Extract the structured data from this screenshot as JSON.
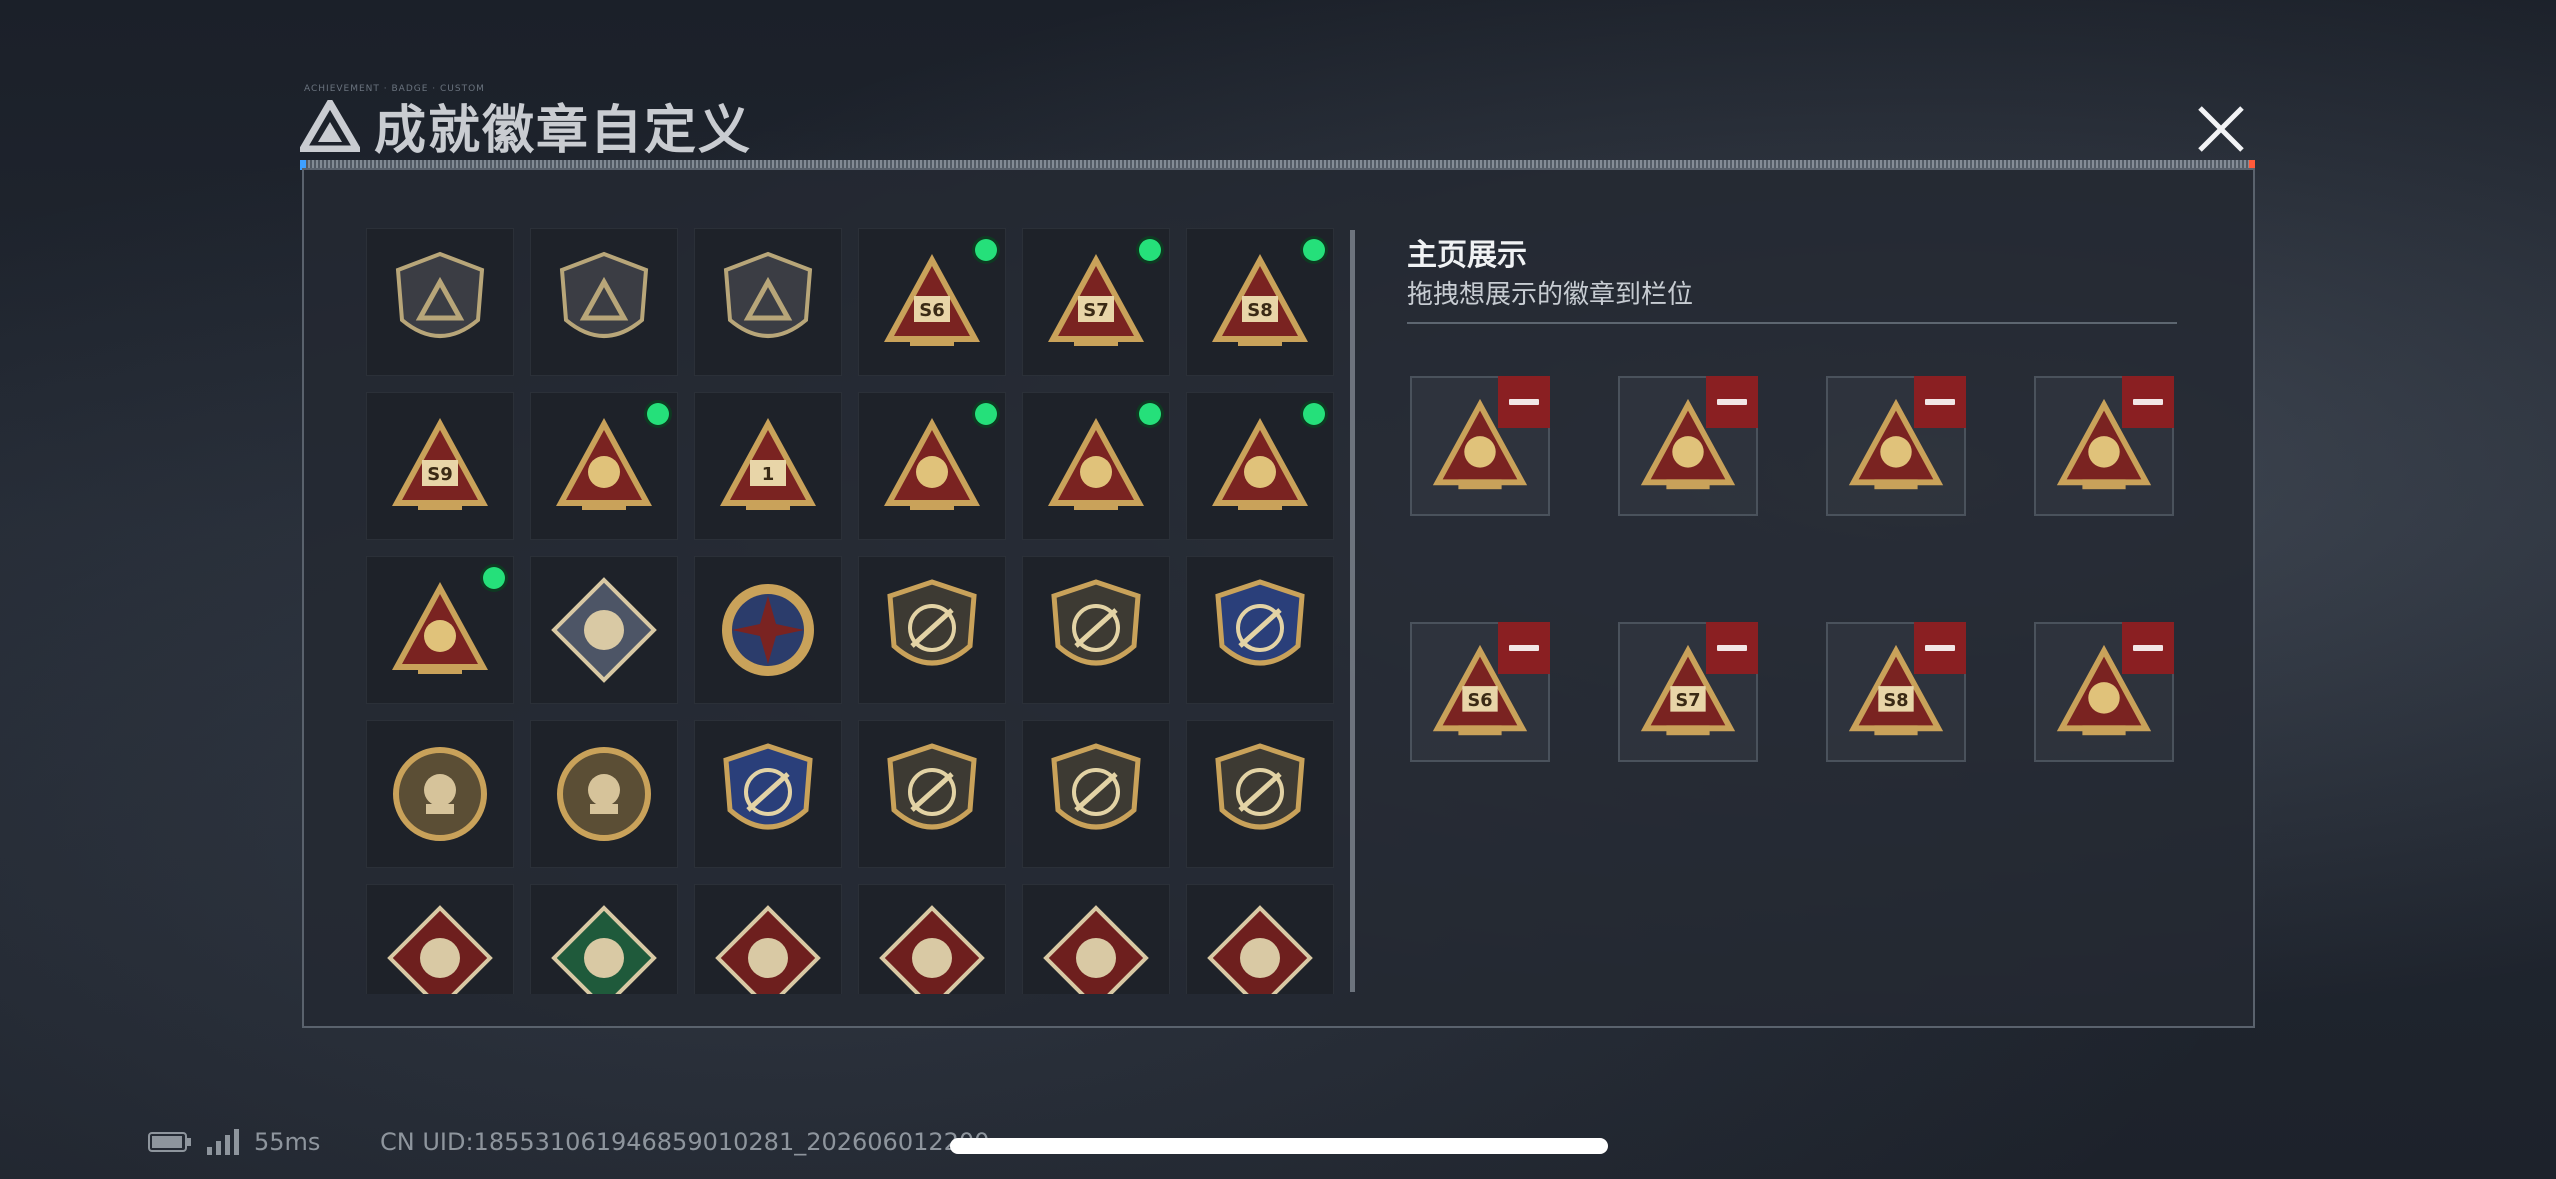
{
  "header": {
    "title": "成就徽章自定义",
    "tiny_text": "ACHIEVEMENT · BADGE · CUSTOM"
  },
  "badge_grid": {
    "rows": [
      [
        {
          "icon": "gray-triangle-shield-icon",
          "new": false
        },
        {
          "icon": "helicopter-shield-icon",
          "new": false
        },
        {
          "icon": "dagger-shield-icon",
          "new": false
        },
        {
          "icon": "s6-triangle-badge-icon",
          "label": "S6",
          "new": true
        },
        {
          "icon": "s7-triangle-badge-icon",
          "label": "S7",
          "new": true
        },
        {
          "icon": "s8-triangle-badge-icon",
          "label": "S8",
          "new": true
        }
      ],
      [
        {
          "icon": "s9-plane-triangle-badge-icon",
          "label": "S9",
          "new": false
        },
        {
          "icon": "boat-triangle-badge-icon",
          "new": true
        },
        {
          "icon": "number-one-triangle-badge-icon",
          "label": "1",
          "new": false
        },
        {
          "icon": "usb-triangle-badge-icon",
          "new": true
        },
        {
          "icon": "dice-triangle-badge-icon",
          "new": true
        },
        {
          "icon": "soldiers-triangle-badge-icon",
          "new": true
        }
      ],
      [
        {
          "icon": "rocket-triangle-badge-icon",
          "new": true
        },
        {
          "icon": "rose-diamond-badge-icon",
          "new": false
        },
        {
          "icon": "star-compass-badge-icon",
          "new": false
        },
        {
          "icon": "wing-shield-badge-icon",
          "new": false
        },
        {
          "icon": "laurel-shield-badge-icon",
          "new": false
        },
        {
          "icon": "blue-gem-shield-badge-icon",
          "new": false
        }
      ],
      [
        {
          "icon": "skull-round-badge-icon",
          "new": false
        },
        {
          "icon": "crosshair-skull-round-badge-icon",
          "new": false
        },
        {
          "icon": "blue-sniper-shield-badge-icon",
          "new": false
        },
        {
          "icon": "rifle-shield-badge-icon",
          "new": false
        },
        {
          "icon": "rifle-round-shield-badge-icon",
          "new": false
        },
        {
          "icon": "gold-rifle-shield-badge-icon",
          "new": false
        }
      ],
      [
        {
          "icon": "wolf-diamond-badge-icon",
          "new": false
        },
        {
          "icon": "green-eagle-diamond-badge-icon",
          "new": false
        },
        {
          "icon": "dragon-diamond-badge-icon",
          "new": false
        },
        {
          "icon": "dragon-red-diamond-badge-icon",
          "new": false
        },
        {
          "icon": "runner-diamond-badge-icon",
          "new": false
        },
        {
          "icon": "horse-diamond-badge-icon",
          "new": false
        }
      ]
    ]
  },
  "display": {
    "title": "主页展示",
    "subtitle": "拖拽想展示的徽章到栏位",
    "slots": [
      {
        "icon": "rocket-triangle-badge-icon"
      },
      {
        "icon": "boat-triangle-badge-icon"
      },
      {
        "icon": "usb-triangle-badge-icon"
      },
      {
        "icon": "dice-triangle-badge-icon"
      },
      {
        "icon": "s6-triangle-badge-icon",
        "label": "S6"
      },
      {
        "icon": "s7-triangle-badge-icon",
        "label": "S7"
      },
      {
        "icon": "s8-triangle-badge-icon",
        "label": "S8"
      },
      {
        "icon": "soldiers-triangle-badge-icon"
      }
    ]
  },
  "status_bar": {
    "ping": "55ms",
    "uid": "CN UID:1855310619468590102​81_202606012200"
  },
  "colors": {
    "new_dot": "#25e07a",
    "remove_button": "#8a1f22",
    "gold": "#c9a25a",
    "badge_red": "#7a2321"
  }
}
